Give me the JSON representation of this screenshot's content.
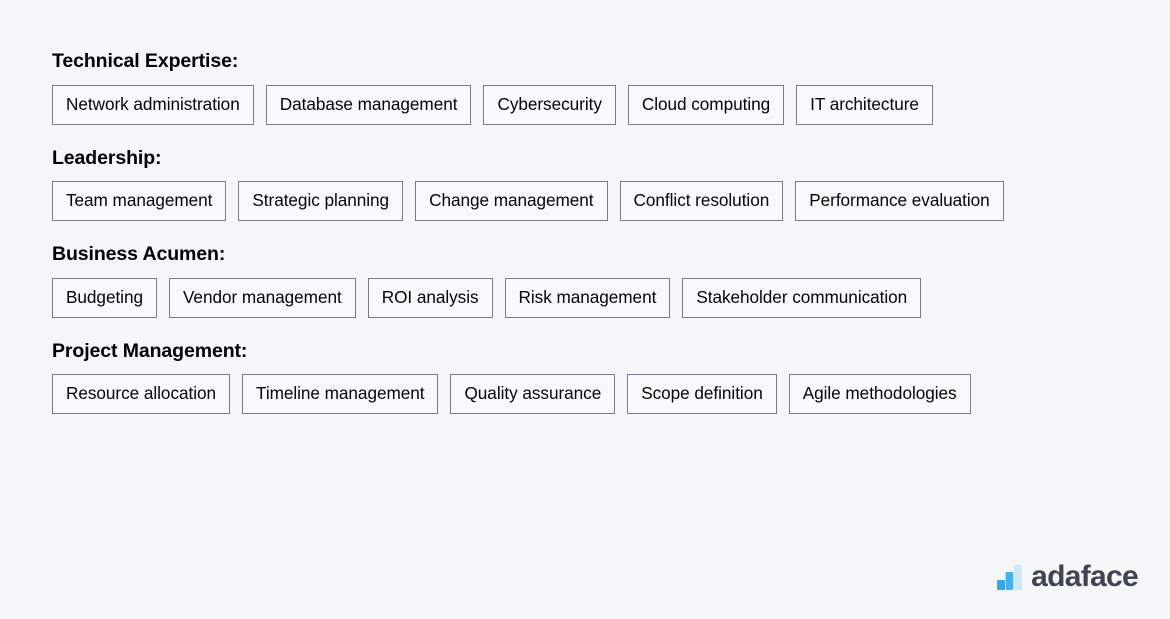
{
  "page": {
    "background_color": "#f4f6f8"
  },
  "sections": [
    {
      "heading": "Technical Expertise:",
      "tags": [
        "Network administration",
        "Database management",
        "Cybersecurity",
        "Cloud computing",
        "IT architecture"
      ]
    },
    {
      "heading": "Leadership:",
      "tags": [
        "Team management",
        "Strategic planning",
        "Change management",
        "Conflict resolution",
        "Performance evaluation"
      ]
    },
    {
      "heading": "Business Acumen:",
      "tags": [
        "Budgeting",
        "Vendor management",
        "ROI analysis",
        "Risk management",
        "Stakeholder communication"
      ]
    },
    {
      "heading": "Project Management:",
      "tags": [
        "Resource allocation",
        "Timeline management",
        "Quality assurance",
        "Scope definition",
        "Agile methodologies"
      ]
    }
  ],
  "logo": {
    "text": "adaface",
    "icon": "bar-chart-icon",
    "text_color": "#3f4450",
    "bar_colors": [
      "#3aa6e8",
      "#49b0ee",
      "#cfe8f9"
    ]
  }
}
